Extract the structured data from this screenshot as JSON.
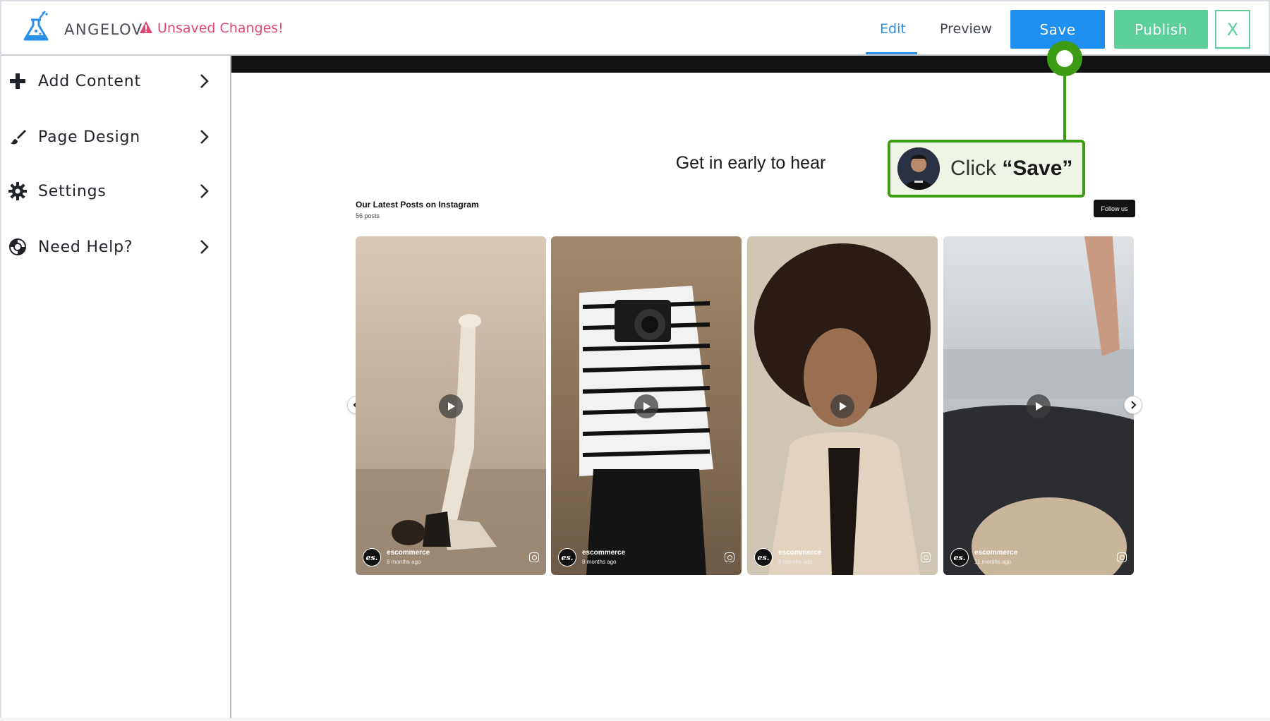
{
  "header": {
    "brand": "ANGELOV",
    "unsaved": "Unsaved Changes!",
    "tabs": {
      "edit": "Edit",
      "preview": "Preview"
    },
    "save": "Save",
    "publish": "Publish",
    "close": "X"
  },
  "sidebar": {
    "items": [
      {
        "label": "Add Content",
        "icon": "plus-icon"
      },
      {
        "label": "Page Design",
        "icon": "brush-icon"
      },
      {
        "label": "Settings",
        "icon": "gear-icon"
      },
      {
        "label": "Need Help?",
        "icon": "lifebuoy-icon"
      }
    ]
  },
  "canvas": {
    "headline": "Get in early to hear",
    "instagram": {
      "title": "Our Latest Posts on Instagram",
      "count": "56 posts",
      "follow": "Follow us",
      "posts": [
        {
          "user": "escommerce",
          "time": "8 months ago"
        },
        {
          "user": "escommerce",
          "time": "8 months ago"
        },
        {
          "user": "escommerce",
          "time": "8 months ago"
        },
        {
          "user": "escommerce",
          "time": "11 months ago"
        }
      ],
      "avatar_text": "es."
    }
  },
  "callout": {
    "prefix": "Click ",
    "target": "“Save”"
  },
  "colors": {
    "accent": "#1f8ff0",
    "publish": "#5ccf9a",
    "warning": "#e2476f",
    "callout_green": "#3b9b12"
  }
}
